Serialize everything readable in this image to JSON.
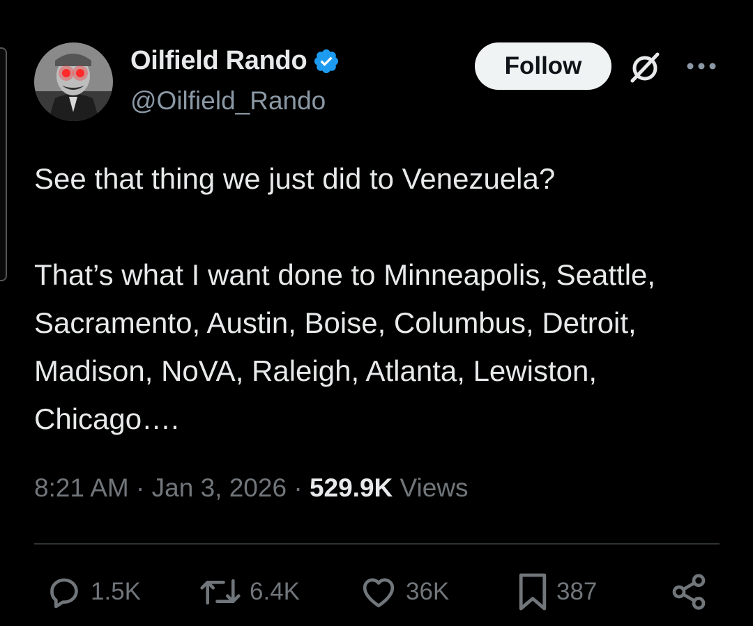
{
  "author": {
    "display_name": "Oilfield Rando",
    "handle": "@Oilfield_Rando",
    "verified": true
  },
  "header_actions": {
    "follow_label": "Follow",
    "grok_icon": "grok-icon",
    "more_icon": "more-icon"
  },
  "tweet": {
    "paragraphs": [
      "See that thing we just did to Venezuela?",
      "That’s what I want done to Minneapolis, Seattle, Sacramento, Austin, Boise, Columbus, Detroit, Madison, NoVA, Raleigh, Atlanta, Lewiston, Chicago…."
    ]
  },
  "meta": {
    "time": "8:21 AM",
    "separator": "·",
    "date": "Jan 3, 2026",
    "views_count": "529.9K",
    "views_label": "Views"
  },
  "actions": {
    "replies": "1.5K",
    "reposts": "6.4K",
    "likes": "36K",
    "bookmarks": "387"
  },
  "colors": {
    "background": "#000000",
    "text": "#e7e9ea",
    "muted": "#71767b",
    "handle": "#8b98a5",
    "verified_blue": "#1d9bf0",
    "follow_bg": "#eff3f4",
    "divider": "#2f3336"
  }
}
